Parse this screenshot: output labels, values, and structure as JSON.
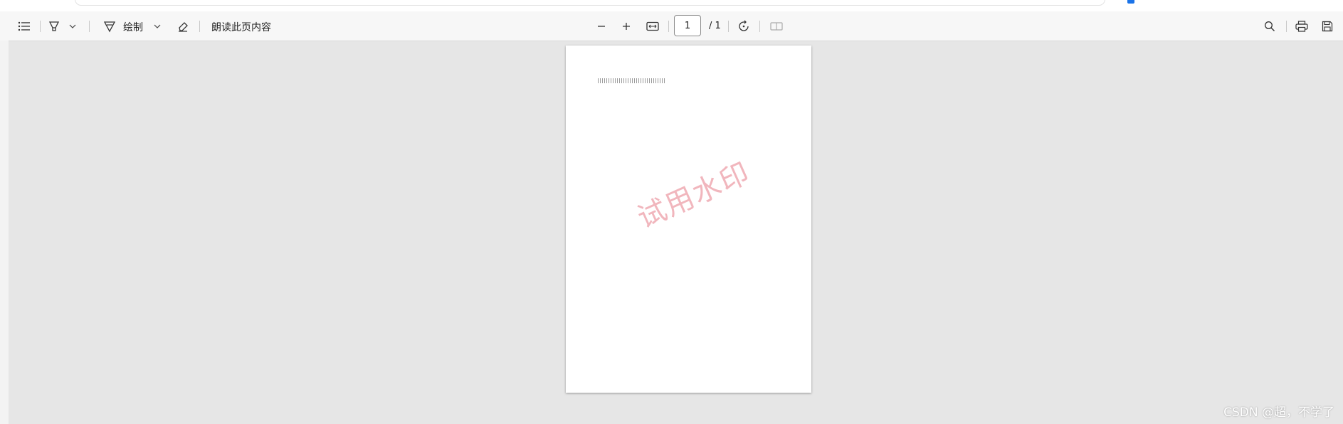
{
  "toolbar": {
    "draw_label": "绘制",
    "read_aloud_label": "朗读此页内容",
    "page_current": "1",
    "page_total": "/ 1"
  },
  "document": {
    "watermark": "试用水印"
  },
  "overlay": {
    "credit": "CSDN @超，不学了"
  },
  "icons": {
    "contents": "list-icon",
    "highlight": "highlighter-icon",
    "draw": "pen-icon",
    "erase": "eraser-icon",
    "zoom_out": "minus-icon",
    "zoom_in": "plus-icon",
    "fit_width": "fit-width-icon",
    "rotate": "rotate-icon",
    "page_view": "page-view-icon",
    "search": "search-icon",
    "print": "print-icon",
    "save": "save-icon"
  },
  "colors": {
    "toolbar_bg": "#f7f7f7",
    "viewer_bg": "#e6e6e6",
    "watermark": "#f1b6bd",
    "accent": "#1a73e8"
  }
}
